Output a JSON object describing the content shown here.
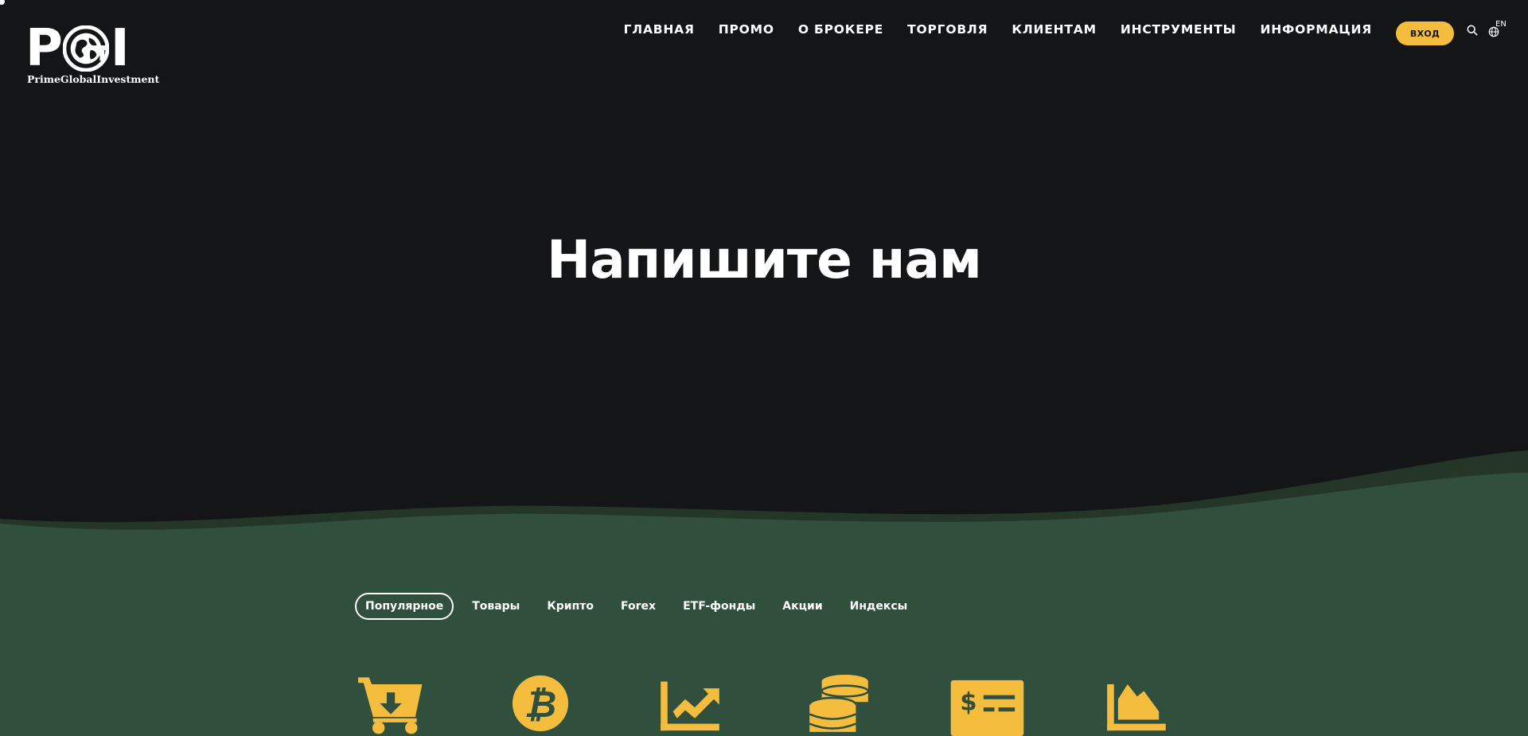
{
  "brand": {
    "logo_letters": [
      "P",
      "G",
      "I"
    ],
    "tagline": "PrimeGlobalInvestment"
  },
  "nav": {
    "items": [
      {
        "label": "ГЛАВНАЯ"
      },
      {
        "label": "ПРОМО"
      },
      {
        "label": "О БРОКЕРЕ"
      },
      {
        "label": "ТОРГОВЛЯ"
      },
      {
        "label": "КЛИЕНТАМ"
      },
      {
        "label": "ИНСТРУМЕНТЫ"
      },
      {
        "label": "ИНФОРМАЦИЯ"
      }
    ],
    "login_label": "ВХОД",
    "language": "EN"
  },
  "hero": {
    "title": "Напишите нам"
  },
  "tabs": [
    {
      "label": "Популярное",
      "active": true
    },
    {
      "label": "Товары",
      "active": false
    },
    {
      "label": "Крипто",
      "active": false
    },
    {
      "label": "Forex",
      "active": false
    },
    {
      "label": "ETF-фонды",
      "active": false
    },
    {
      "label": "Акции",
      "active": false
    },
    {
      "label": "Индексы",
      "active": false
    }
  ],
  "category_icons": [
    "cart-download-icon",
    "bitcoin-icon",
    "trend-up-icon",
    "coins-icon",
    "money-check-icon",
    "area-chart-icon"
  ],
  "colors": {
    "background": "#141517",
    "accent": "#f5bd3e",
    "green": "#30503d",
    "green_dark": "#243628",
    "text": "#ffffff"
  }
}
